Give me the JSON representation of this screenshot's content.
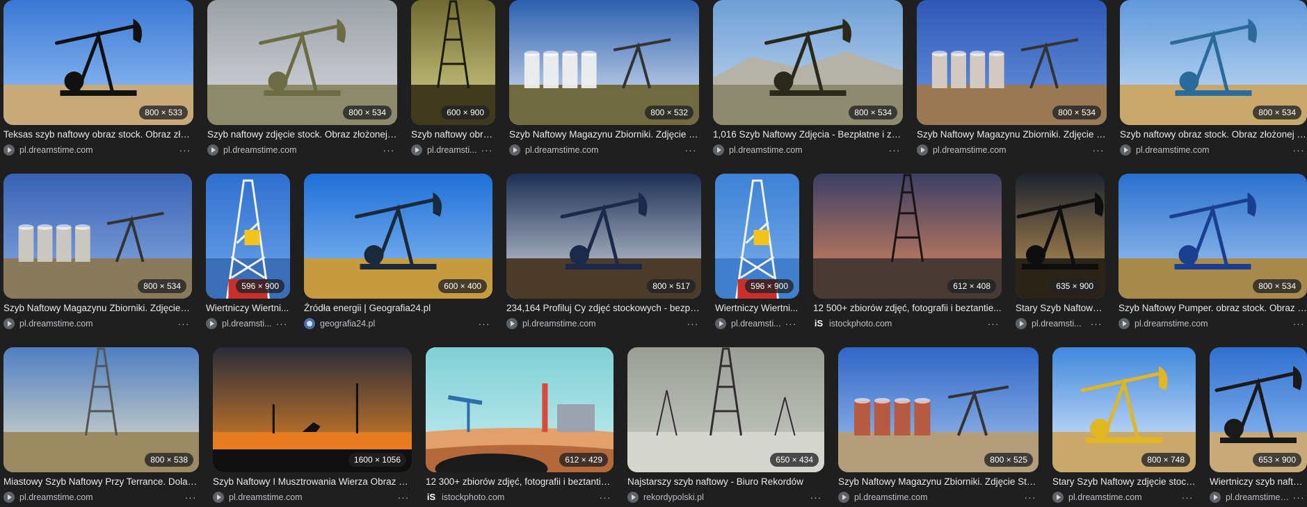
{
  "results": [
    {
      "title": "Teksas szyb naftowy obraz stock. Obraz złożonej z...",
      "source": "pl.dreamstime.com",
      "dims": "800 × 533",
      "favicon": "dreamstime",
      "more": "···"
    },
    {
      "title": "Szyb naftowy zdjęcie stock. Obraz złożonej z...",
      "source": "pl.dreamstime.com",
      "dims": "800 × 534",
      "favicon": "dreamstime",
      "more": "···"
    },
    {
      "title": "Szyb naftowy obra...",
      "source": "pl.dreamsti...",
      "dims": "600 × 900",
      "favicon": "dreamstime",
      "more": "···"
    },
    {
      "title": "Szyb Naftowy Magazynu Zbiorniki. Zdjęcie St...",
      "source": "pl.dreamstime.com",
      "dims": "800 × 532",
      "favicon": "dreamstime",
      "more": "···"
    },
    {
      "title": "1,016 Szyb Naftowy Zdjęcia - Bezpłatne i z lic...",
      "source": "pl.dreamstime.com",
      "dims": "800 × 534",
      "favicon": "dreamstime",
      "more": "···"
    },
    {
      "title": "Szyb Naftowy Magazynu Zbiorniki. Zdjęcie St...",
      "source": "pl.dreamstime.com",
      "dims": "800 × 534",
      "favicon": "dreamstime",
      "more": "···"
    },
    {
      "title": "Szyb naftowy obraz stock. Obraz złożonej z...",
      "source": "pl.dreamstime.com",
      "dims": "800 × 534",
      "favicon": "dreamstime",
      "more": "···"
    },
    {
      "title": "Szyb Naftowy Magazynu Zbiorniki. Zdjęcie St...",
      "source": "pl.dreamstime.com",
      "dims": "800 × 534",
      "favicon": "dreamstime",
      "more": "···"
    },
    {
      "title": "Wiertniczy Wiertni...",
      "source": "pl.dreamsti...",
      "dims": "596 × 900",
      "favicon": "dreamstime",
      "more": "···"
    },
    {
      "title": "Źródła energii | Geografia24.pl",
      "source": "geografia24.pl",
      "dims": "600 × 400",
      "favicon": "geografia",
      "more": "···"
    },
    {
      "title": "234,164 Profiluj Cy zdjęć stockowych - bezpłat...",
      "source": "pl.dreamstime.com",
      "dims": "800 × 517",
      "favicon": "dreamstime",
      "more": "···"
    },
    {
      "title": "Wiertniczy Wiertni...",
      "source": "pl.dreamsti...",
      "dims": "596 × 900",
      "favicon": "dreamstime",
      "more": "···"
    },
    {
      "title": "12 500+ zbiorów zdjęć, fotografii i beztantie...",
      "source": "istockphoto.com",
      "dims": "612 × 408",
      "favicon": "istock",
      "favicon_text": "iS",
      "more": "···"
    },
    {
      "title": "Stary Szyb Naftowy ...",
      "source": "pl.dreamsti...",
      "dims": "635 × 900",
      "favicon": "dreamstime",
      "more": "···"
    },
    {
      "title": "Szyb Naftowy Pumper. obraz stock. Obraz zł...",
      "source": "pl.dreamstime.com",
      "dims": "800 × 534",
      "favicon": "dreamstime",
      "more": "···"
    },
    {
      "title": "Miastowy Szyb Naftowy Przy Terrance. Dolam...",
      "source": "pl.dreamstime.com",
      "dims": "800 × 538",
      "favicon": "dreamstime",
      "more": "···"
    },
    {
      "title": "Szyb Naftowy I Musztrowania Wierza Obraz Sto...",
      "source": "pl.dreamstime.com",
      "dims": "1600 × 1056",
      "favicon": "dreamstime",
      "more": "···"
    },
    {
      "title": "12 300+ zbiorów zdjęć, fotografii i beztantie...",
      "source": "istockphoto.com",
      "dims": "612 × 429",
      "favicon": "istock",
      "favicon_text": "iS",
      "more": "···"
    },
    {
      "title": "Najstarszy szyb naftowy - Biuro Rekordów",
      "source": "rekordypolski.pl",
      "dims": "650 × 434",
      "favicon": "dreamstime",
      "more": "···"
    },
    {
      "title": "Szyb Naftowy Magazynu Zbiorniki. Zdjęcie Stoc...",
      "source": "pl.dreamstime.com",
      "dims": "800 × 525",
      "favicon": "dreamstime",
      "more": "···"
    },
    {
      "title": "Stary Szyb Naftowy zdjęcie stocko...",
      "source": "pl.dreamstime.com",
      "dims": "800 × 748",
      "favicon": "dreamstime",
      "more": "···"
    },
    {
      "title": "Wiertniczy szyb naftowy...",
      "source": "pl.dreamstime.com",
      "dims": "653 × 900",
      "favicon": "dreamstime",
      "more": "···"
    }
  ]
}
